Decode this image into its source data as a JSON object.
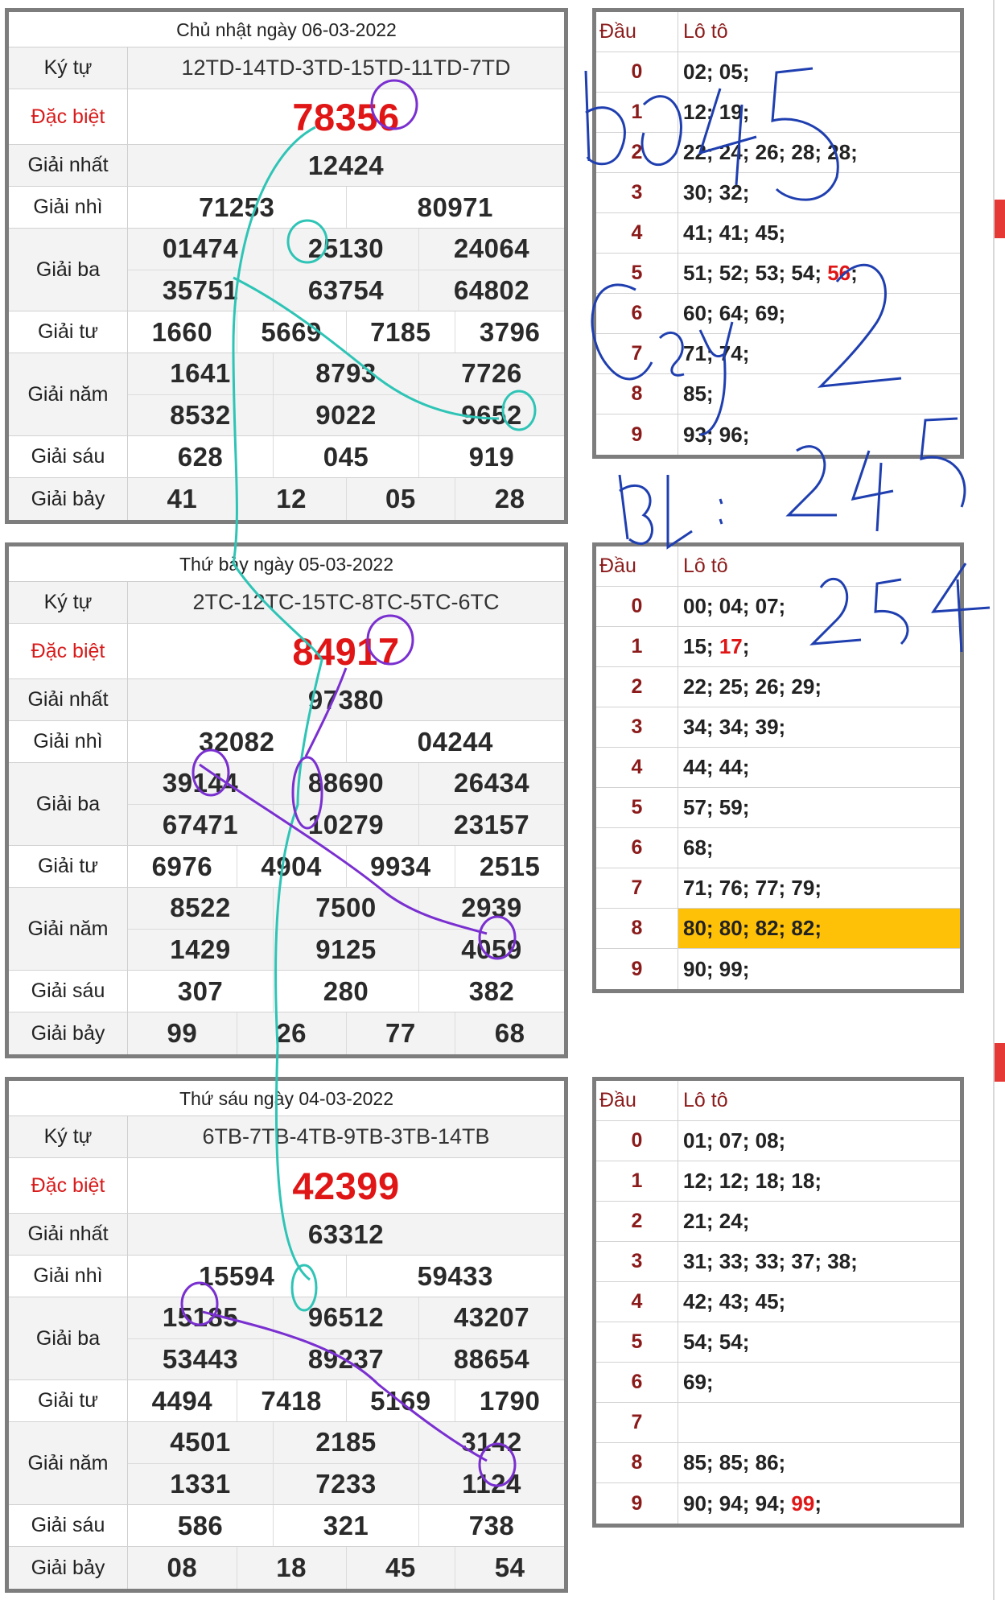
{
  "days": [
    {
      "title": "Chủ nhật ngày 06-03-2022",
      "kytu": "12TD-14TD-3TD-15TD-11TD-7TD",
      "dacbiet": "78356",
      "g1": "12424",
      "g2": [
        "71253",
        "80971"
      ],
      "g3": [
        "01474",
        "25130",
        "24064",
        "35751",
        "63754",
        "64802"
      ],
      "g4": [
        "1660",
        "5669",
        "7185",
        "3796"
      ],
      "g5": [
        "1641",
        "8793",
        "7726",
        "8532",
        "9022",
        "9652"
      ],
      "g6": [
        "628",
        "045",
        "919"
      ],
      "g7": [
        "41",
        "12",
        "05",
        "28"
      ]
    },
    {
      "title": "Thứ bảy ngày 05-03-2022",
      "kytu": "2TC-12TC-15TC-8TC-5TC-6TC",
      "dacbiet": "84917",
      "g1": "97380",
      "g2": [
        "32082",
        "04244"
      ],
      "g3": [
        "39144",
        "88690",
        "26434",
        "67471",
        "10279",
        "23157"
      ],
      "g4": [
        "6976",
        "4904",
        "9934",
        "2515"
      ],
      "g5": [
        "8522",
        "7500",
        "2939",
        "1429",
        "9125",
        "4059"
      ],
      "g6": [
        "307",
        "280",
        "382"
      ],
      "g7": [
        "99",
        "26",
        "77",
        "68"
      ]
    },
    {
      "title": "Thứ sáu ngày 04-03-2022",
      "kytu": "6TB-7TB-4TB-9TB-3TB-14TB",
      "dacbiet": "42399",
      "g1": "63312",
      "g2": [
        "15594",
        "59433"
      ],
      "g3": [
        "15185",
        "96512",
        "43207",
        "53443",
        "89237",
        "88654"
      ],
      "g4": [
        "4494",
        "7418",
        "5169",
        "1790"
      ],
      "g5": [
        "4501",
        "2185",
        "3142",
        "1331",
        "7233",
        "1124"
      ],
      "g6": [
        "586",
        "321",
        "738"
      ],
      "g7": [
        "08",
        "18",
        "45",
        "54"
      ]
    }
  ],
  "labels": {
    "kytu": "Ký tự",
    "dacbiet": "Đặc biệt",
    "g1": "Giải nhất",
    "g2": "Giải nhì",
    "g3": "Giải ba",
    "g4": "Giải tư",
    "g5": "Giải năm",
    "g6": "Giải sáu",
    "g7": "Giải bảy",
    "dau": "Đầu",
    "loto": "Lô tô"
  },
  "loto": [
    {
      "rows": [
        {
          "dau": "0",
          "nums": "02; 05;"
        },
        {
          "dau": "1",
          "nums": "12; 19;"
        },
        {
          "dau": "2",
          "nums": "22; 24; 26; 28; 28;"
        },
        {
          "dau": "3",
          "nums": "30; 32;"
        },
        {
          "dau": "4",
          "nums": "41; 41; 45;"
        },
        {
          "dau": "5",
          "nums": "51; 52; 53; 54; ",
          "red": "56",
          "after": ";"
        },
        {
          "dau": "6",
          "nums": "60; 64; 69;"
        },
        {
          "dau": "7",
          "nums": "71; 74;"
        },
        {
          "dau": "8",
          "nums": "85;"
        },
        {
          "dau": "9",
          "nums": "93; 96;"
        }
      ]
    },
    {
      "rows": [
        {
          "dau": "0",
          "nums": "00; 04; 07;"
        },
        {
          "dau": "1",
          "nums": "15; ",
          "red": "17",
          "after": ";"
        },
        {
          "dau": "2",
          "nums": "22; 25; 26; 29;"
        },
        {
          "dau": "3",
          "nums": "34; 34; 39;"
        },
        {
          "dau": "4",
          "nums": "44; 44;"
        },
        {
          "dau": "5",
          "nums": "57; 59;"
        },
        {
          "dau": "6",
          "nums": "68;"
        },
        {
          "dau": "7",
          "nums": "71; 76; 77; 79;"
        },
        {
          "dau": "8",
          "nums": "80; 80; 82; 82;",
          "highlight": true
        },
        {
          "dau": "9",
          "nums": "90; 99;"
        }
      ]
    },
    {
      "rows": [
        {
          "dau": "0",
          "nums": "01; 07; 08;"
        },
        {
          "dau": "1",
          "nums": "12; 12; 18; 18;"
        },
        {
          "dau": "2",
          "nums": "21; 24;"
        },
        {
          "dau": "3",
          "nums": "31; 33; 33; 37; 38;"
        },
        {
          "dau": "4",
          "nums": "42; 43; 45;"
        },
        {
          "dau": "5",
          "nums": "54; 54;"
        },
        {
          "dau": "6",
          "nums": "69;"
        },
        {
          "dau": "7",
          "nums": ""
        },
        {
          "dau": "8",
          "nums": "85; 85; 86;"
        },
        {
          "dau": "9",
          "nums": "90; 94; 94; ",
          "red": "99",
          "after": ";"
        }
      ]
    }
  ],
  "colors": {
    "accent_red": "#e01515",
    "dau_red": "#8b1a1a",
    "highlight": "#ffc107",
    "border": "#7d7d7d",
    "ink_blue": "#1f3fb0",
    "ink_teal": "#2ec4b6",
    "ink_purple": "#7a2fd0"
  },
  "handwriting": {
    "note1": "BD: 45",
    "note2": "Cầu 2",
    "note3": "BL: 245",
    "note4": "254"
  }
}
